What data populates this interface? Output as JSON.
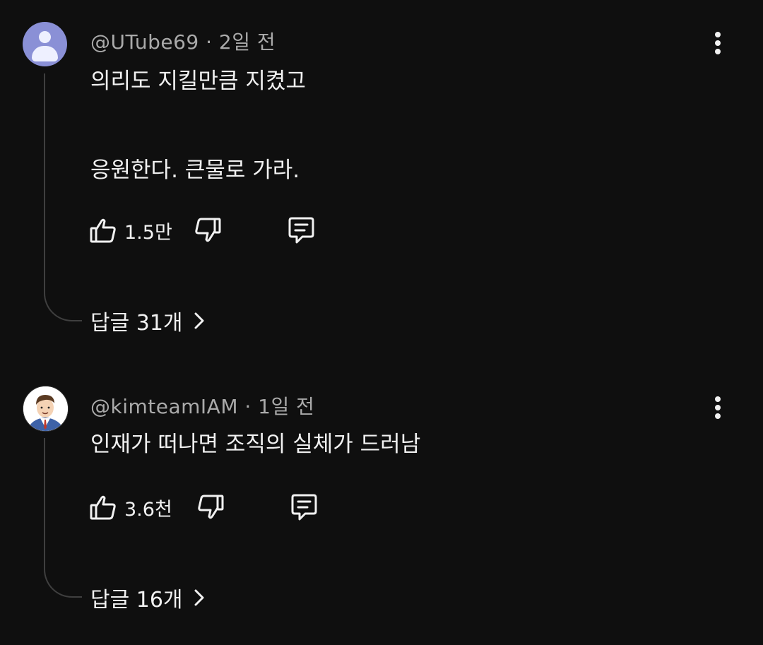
{
  "comments": [
    {
      "author": "@UTube69",
      "time": "2일 전",
      "meta": "@UTube69 · 2일 전",
      "text": "의리도 지킬만큼 지켰고\n\n\n응원한다. 큰물로 가라.",
      "likes": "1.5만",
      "replies": "답글 31개",
      "avatar": "default-person-icon"
    },
    {
      "author": "@kimteamIAM",
      "time": "1일 전",
      "meta": "@kimteamIAM · 1일 전",
      "text": "인재가 떠나면 조직의 실체가 드러남",
      "likes": "3.6천",
      "replies": "답글 16개",
      "avatar": "cartoon-businessman-avatar"
    }
  ],
  "icons": {
    "like": "thumbs-up-icon",
    "dislike": "thumbs-down-icon",
    "reply": "comment-reply-icon",
    "more": "more-vertical-icon",
    "expand": "chevron-right-icon"
  },
  "colors": {
    "background": "#0f0f0f",
    "text": "#f1f1f1",
    "meta": "#aaaaaa",
    "thread_line": "#3f3f3f",
    "avatar_default": "#8a90d6"
  }
}
